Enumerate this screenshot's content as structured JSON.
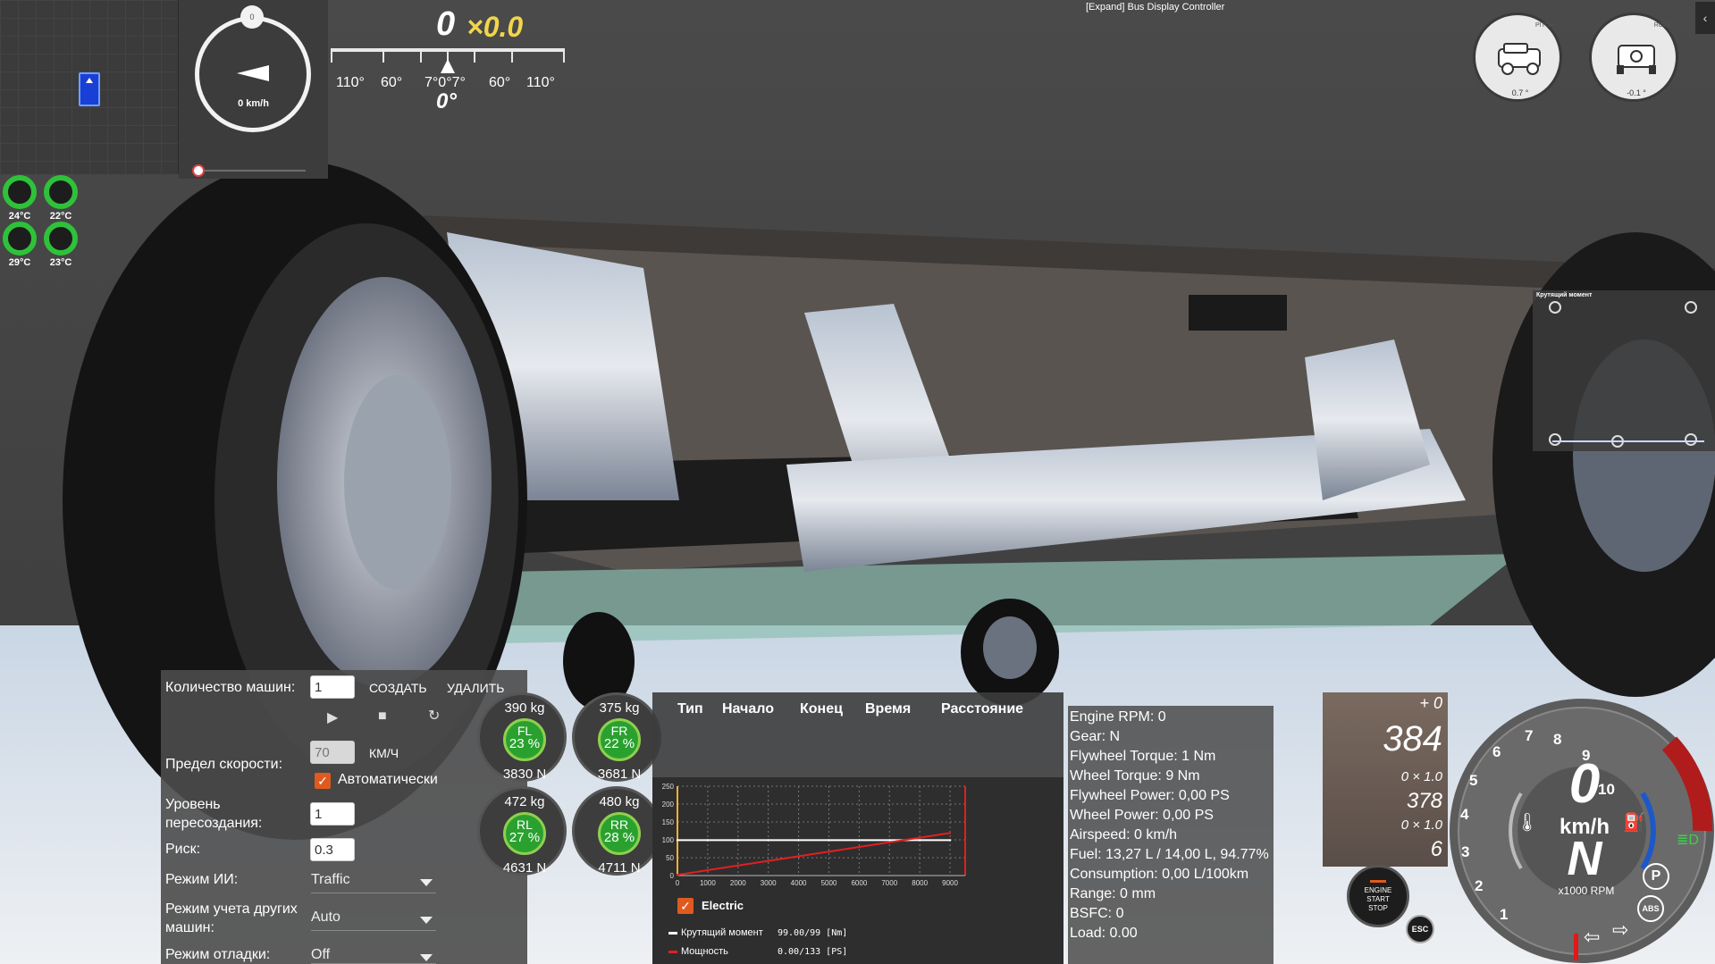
{
  "window": {
    "title": "[Expand] Bus Display Controller",
    "collapse_icon": "chevron-left-icon"
  },
  "compass": {
    "top_marker": "0",
    "speed": "0 km/h"
  },
  "steering": {
    "value": "0",
    "multiplier": "×0.0",
    "angle": "0°",
    "tick_labels": [
      "110°",
      "60°",
      "7°0°7°",
      "60°",
      "110°"
    ]
  },
  "tire_temps": [
    {
      "label": "24°C"
    },
    {
      "label": "22°C"
    },
    {
      "label": "29°C"
    },
    {
      "label": "23°C"
    }
  ],
  "tilt": {
    "pitch": {
      "name": "PITCH",
      "value": "0.7 °"
    },
    "roll": {
      "name": "ROLL",
      "value": "-0.1 °"
    }
  },
  "torque_panel": {
    "title": "Крутящий момент"
  },
  "ai_panel": {
    "count_label": "Количество машин:",
    "count_value": "1",
    "create_label": "СОЗДАТЬ",
    "delete_label": "УДАЛИТЬ",
    "speed_limit_label": "Предел скорости:",
    "speed_limit_value": "70",
    "speed_unit": "КМ/Ч",
    "auto_label": "Автоматически",
    "respawn_label": "Уровень пересоздания:",
    "respawn_value": "1",
    "risk_label": "Риск:",
    "risk_value": "0.3",
    "ai_mode_label": "Режим ИИ:",
    "ai_mode_value": "Traffic",
    "others_label": "Режим учета других машин:",
    "others_value": "Auto",
    "debug_label": "Режим отладки:",
    "debug_value": "Off"
  },
  "wheel_loads": [
    {
      "name": "FL",
      "kg": "390  kg",
      "pct": "23  %",
      "n": "3830  N"
    },
    {
      "name": "FR",
      "kg": "375  kg",
      "pct": "22  %",
      "n": "3681  N"
    },
    {
      "name": "RL",
      "kg": "472  kg",
      "pct": "27  %",
      "n": "4631  N"
    },
    {
      "name": "RR",
      "kg": "480  kg",
      "pct": "28  %",
      "n": "4711  N"
    }
  ],
  "log_table": {
    "headers": [
      "Тип",
      "Начало",
      "Конец",
      "Время",
      "Расстояние"
    ]
  },
  "graph": {
    "electric_label": "Electric",
    "torque_label": "Крутящий момент",
    "torque_value": "99.00/99 [Nm]",
    "power_label": "Мощность",
    "power_value": "0.00/133 [PS]",
    "colors": {
      "torque": "#ffffff",
      "power": "#e02020",
      "axis_left": "#f2b233"
    }
  },
  "chart_data": {
    "type": "line",
    "x": [
      0,
      1000,
      2000,
      3000,
      4000,
      5000,
      6000,
      7000,
      8000,
      9000
    ],
    "xlim": [
      0,
      9500
    ],
    "ylim": [
      0,
      250
    ],
    "x_ticks": [
      "0",
      "1000",
      "2000",
      "3000",
      "4000",
      "5000",
      "6000",
      "7000",
      "8000",
      "9000"
    ],
    "y_ticks": [
      "0",
      "50",
      "100",
      "150",
      "200",
      "250"
    ],
    "series": [
      {
        "name": "Крутящий момент",
        "values": [
          99,
          99,
          99,
          99,
          99,
          99,
          99,
          99,
          99,
          99
        ]
      },
      {
        "name": "Мощность",
        "values": [
          2,
          15,
          28,
          41,
          54,
          67,
          80,
          93,
          106,
          119
        ]
      }
    ],
    "grid": true
  },
  "engine_stats": [
    "Engine RPM: 0",
    "Gear: N",
    "Flywheel Torque: 1 Nm",
    "Wheel Torque: 9 Nm",
    "Flywheel Power: 0,00 PS",
    "Wheel Power: 0,00 PS",
    "Airspeed: 0 km/h",
    "Fuel: 13,27 L / 14,00 L, 94.77%",
    "Consumption: 0,00 L/100km",
    "Range: 0 mm",
    "BSFC: 0",
    "Load: 0.00"
  ],
  "gear_column": {
    "delta": "+ 0",
    "value1": "384",
    "mult1": "0 × 1.0",
    "value2": "378",
    "mult2": "0 × 1.0",
    "value3": "6"
  },
  "engine_button": {
    "line1": "ENGINE",
    "line2": "START",
    "line3": "STOP",
    "esc": "ESC"
  },
  "tacho": {
    "speed": "0",
    "unit": "km/h",
    "gear": "N",
    "rpm_unit": "x1000 RPM",
    "numbers": [
      "1",
      "2",
      "3",
      "4",
      "5",
      "6",
      "7",
      "8",
      "9",
      "10"
    ],
    "icons": [
      "temperature-icon",
      "fuel-icon",
      "headlight-icon",
      "parking-brake-icon",
      "abs-icon",
      "turn-left-icon",
      "turn-right-icon"
    ]
  }
}
